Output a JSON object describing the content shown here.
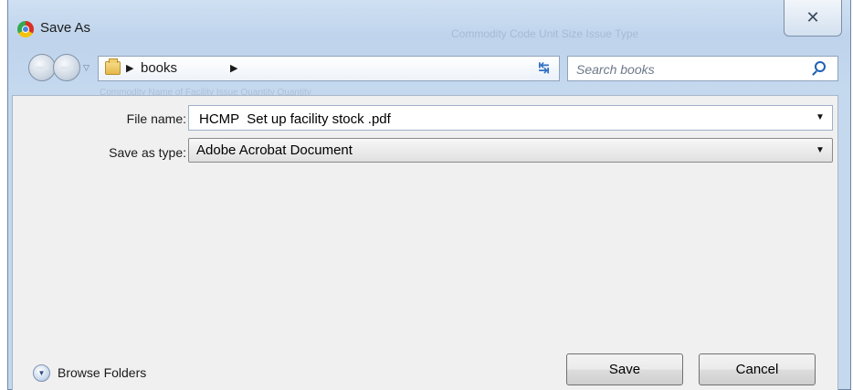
{
  "window": {
    "title": "Save As",
    "close_label": "✕"
  },
  "background_text": {
    "header_cols": "Commodity Code   Unit Size   Issue Type",
    "sub_cols": "Commodity   Name of Facility   Issue Quantity   Quantity"
  },
  "navigation": {
    "breadcrumb": [
      "books"
    ]
  },
  "search": {
    "placeholder": "Search books"
  },
  "form": {
    "file_name_label": "File name:",
    "file_name_value": "HCMP  Set up facility stock .pdf",
    "save_as_type_label": "Save as type:",
    "save_as_type_value": "Adobe Acrobat Document"
  },
  "footer": {
    "browse_folders_label": "Browse Folders",
    "save_label": "Save",
    "cancel_label": "Cancel"
  },
  "colors": {
    "frame": "#bfd4ec",
    "panel": "#f0f0f0",
    "accent": "#2f6fc4"
  }
}
